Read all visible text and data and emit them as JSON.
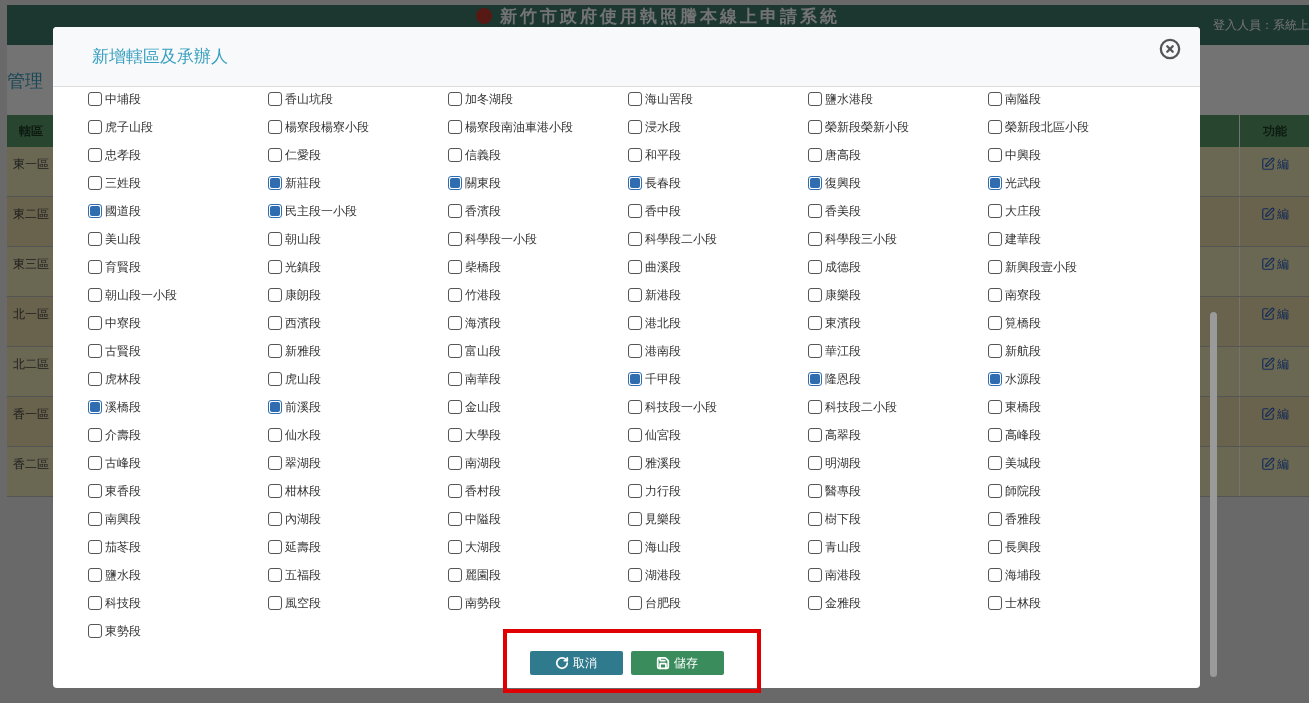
{
  "page": {
    "header_title": "新竹市政府使用執照謄本線上申請系統",
    "user_label": "登入人員：系統上",
    "heading": "管理",
    "columns": [
      "轄區",
      "功能"
    ],
    "rows": [
      {
        "district": "東一區",
        "action": "編"
      },
      {
        "district": "東二區",
        "action": "編"
      },
      {
        "district": "東三區",
        "action": "編"
      },
      {
        "district": "北一區",
        "action": "編"
      },
      {
        "district": "北二區",
        "action": "編"
      },
      {
        "district": "香一區",
        "action": "編"
      },
      {
        "district": "香二區",
        "action": "編"
      }
    ]
  },
  "modal": {
    "title": "新增轄區及承辦人",
    "sections": [
      {
        "label": "中埔段",
        "checked": false
      },
      {
        "label": "香山坑段",
        "checked": false
      },
      {
        "label": "加冬湖段",
        "checked": false
      },
      {
        "label": "海山罟段",
        "checked": false
      },
      {
        "label": "鹽水港段",
        "checked": false
      },
      {
        "label": "南隘段",
        "checked": false
      },
      {
        "label": "虎子山段",
        "checked": false
      },
      {
        "label": "楊寮段楊寮小段",
        "checked": false
      },
      {
        "label": "楊寮段南油車港小段",
        "checked": false
      },
      {
        "label": "浸水段",
        "checked": false
      },
      {
        "label": "榮新段榮新小段",
        "checked": false
      },
      {
        "label": "榮新段北區小段",
        "checked": false
      },
      {
        "label": "忠孝段",
        "checked": false
      },
      {
        "label": "仁愛段",
        "checked": false
      },
      {
        "label": "信義段",
        "checked": false
      },
      {
        "label": "和平段",
        "checked": false
      },
      {
        "label": "唐高段",
        "checked": false
      },
      {
        "label": "中興段",
        "checked": false
      },
      {
        "label": "三姓段",
        "checked": false
      },
      {
        "label": "新莊段",
        "checked": true
      },
      {
        "label": "關東段",
        "checked": true
      },
      {
        "label": "長春段",
        "checked": true
      },
      {
        "label": "復興段",
        "checked": true
      },
      {
        "label": "光武段",
        "checked": true
      },
      {
        "label": "國道段",
        "checked": true
      },
      {
        "label": "民主段一小段",
        "checked": true
      },
      {
        "label": "香濱段",
        "checked": false
      },
      {
        "label": "香中段",
        "checked": false
      },
      {
        "label": "香美段",
        "checked": false
      },
      {
        "label": "大庄段",
        "checked": false
      },
      {
        "label": "美山段",
        "checked": false
      },
      {
        "label": "朝山段",
        "checked": false
      },
      {
        "label": "科學段一小段",
        "checked": false
      },
      {
        "label": "科學段二小段",
        "checked": false
      },
      {
        "label": "科學段三小段",
        "checked": false
      },
      {
        "label": "建華段",
        "checked": false
      },
      {
        "label": "育賢段",
        "checked": false
      },
      {
        "label": "光鎮段",
        "checked": false
      },
      {
        "label": "柴橋段",
        "checked": false
      },
      {
        "label": "曲溪段",
        "checked": false
      },
      {
        "label": "成德段",
        "checked": false
      },
      {
        "label": "新興段壹小段",
        "checked": false
      },
      {
        "label": "朝山段一小段",
        "checked": false
      },
      {
        "label": "康朗段",
        "checked": false
      },
      {
        "label": "竹港段",
        "checked": false
      },
      {
        "label": "新港段",
        "checked": false
      },
      {
        "label": "康樂段",
        "checked": false
      },
      {
        "label": "南寮段",
        "checked": false
      },
      {
        "label": "中寮段",
        "checked": false
      },
      {
        "label": "西濱段",
        "checked": false
      },
      {
        "label": "海濱段",
        "checked": false
      },
      {
        "label": "港北段",
        "checked": false
      },
      {
        "label": "東濱段",
        "checked": false
      },
      {
        "label": "筧橋段",
        "checked": false
      },
      {
        "label": "古賢段",
        "checked": false
      },
      {
        "label": "新雅段",
        "checked": false
      },
      {
        "label": "富山段",
        "checked": false
      },
      {
        "label": "港南段",
        "checked": false
      },
      {
        "label": "華江段",
        "checked": false
      },
      {
        "label": "新航段",
        "checked": false
      },
      {
        "label": "虎林段",
        "checked": false
      },
      {
        "label": "虎山段",
        "checked": false
      },
      {
        "label": "南華段",
        "checked": false
      },
      {
        "label": "千甲段",
        "checked": true
      },
      {
        "label": "隆恩段",
        "checked": true
      },
      {
        "label": "水源段",
        "checked": true
      },
      {
        "label": "溪橋段",
        "checked": true
      },
      {
        "label": "前溪段",
        "checked": true
      },
      {
        "label": "金山段",
        "checked": false
      },
      {
        "label": "科技段一小段",
        "checked": false
      },
      {
        "label": "科技段二小段",
        "checked": false
      },
      {
        "label": "東橋段",
        "checked": false
      },
      {
        "label": "介壽段",
        "checked": false
      },
      {
        "label": "仙水段",
        "checked": false
      },
      {
        "label": "大學段",
        "checked": false
      },
      {
        "label": "仙宮段",
        "checked": false
      },
      {
        "label": "高翠段",
        "checked": false
      },
      {
        "label": "高峰段",
        "checked": false
      },
      {
        "label": "古峰段",
        "checked": false
      },
      {
        "label": "翠湖段",
        "checked": false
      },
      {
        "label": "南湖段",
        "checked": false
      },
      {
        "label": "雅溪段",
        "checked": false
      },
      {
        "label": "明湖段",
        "checked": false
      },
      {
        "label": "美城段",
        "checked": false
      },
      {
        "label": "東香段",
        "checked": false
      },
      {
        "label": "柑林段",
        "checked": false
      },
      {
        "label": "香村段",
        "checked": false
      },
      {
        "label": "力行段",
        "checked": false
      },
      {
        "label": "醫專段",
        "checked": false
      },
      {
        "label": "師院段",
        "checked": false
      },
      {
        "label": "南興段",
        "checked": false
      },
      {
        "label": "內湖段",
        "checked": false
      },
      {
        "label": "中隘段",
        "checked": false
      },
      {
        "label": "見樂段",
        "checked": false
      },
      {
        "label": "樹下段",
        "checked": false
      },
      {
        "label": "香雅段",
        "checked": false
      },
      {
        "label": "茄苳段",
        "checked": false
      },
      {
        "label": "延壽段",
        "checked": false
      },
      {
        "label": "大湖段",
        "checked": false
      },
      {
        "label": "海山段",
        "checked": false
      },
      {
        "label": "青山段",
        "checked": false
      },
      {
        "label": "長興段",
        "checked": false
      },
      {
        "label": "鹽水段",
        "checked": false
      },
      {
        "label": "五福段",
        "checked": false
      },
      {
        "label": "麗園段",
        "checked": false
      },
      {
        "label": "湖港段",
        "checked": false
      },
      {
        "label": "南港段",
        "checked": false
      },
      {
        "label": "海埔段",
        "checked": false
      },
      {
        "label": "科技段",
        "checked": false
      },
      {
        "label": "風空段",
        "checked": false
      },
      {
        "label": "南勢段",
        "checked": false
      },
      {
        "label": "台肥段",
        "checked": false
      },
      {
        "label": "金雅段",
        "checked": false
      },
      {
        "label": "士林段",
        "checked": false
      },
      {
        "label": "東勢段",
        "checked": false
      }
    ],
    "buttons": [
      {
        "kind": "cancel",
        "label": "取消"
      },
      {
        "kind": "save",
        "label": "儲存"
      }
    ]
  }
}
